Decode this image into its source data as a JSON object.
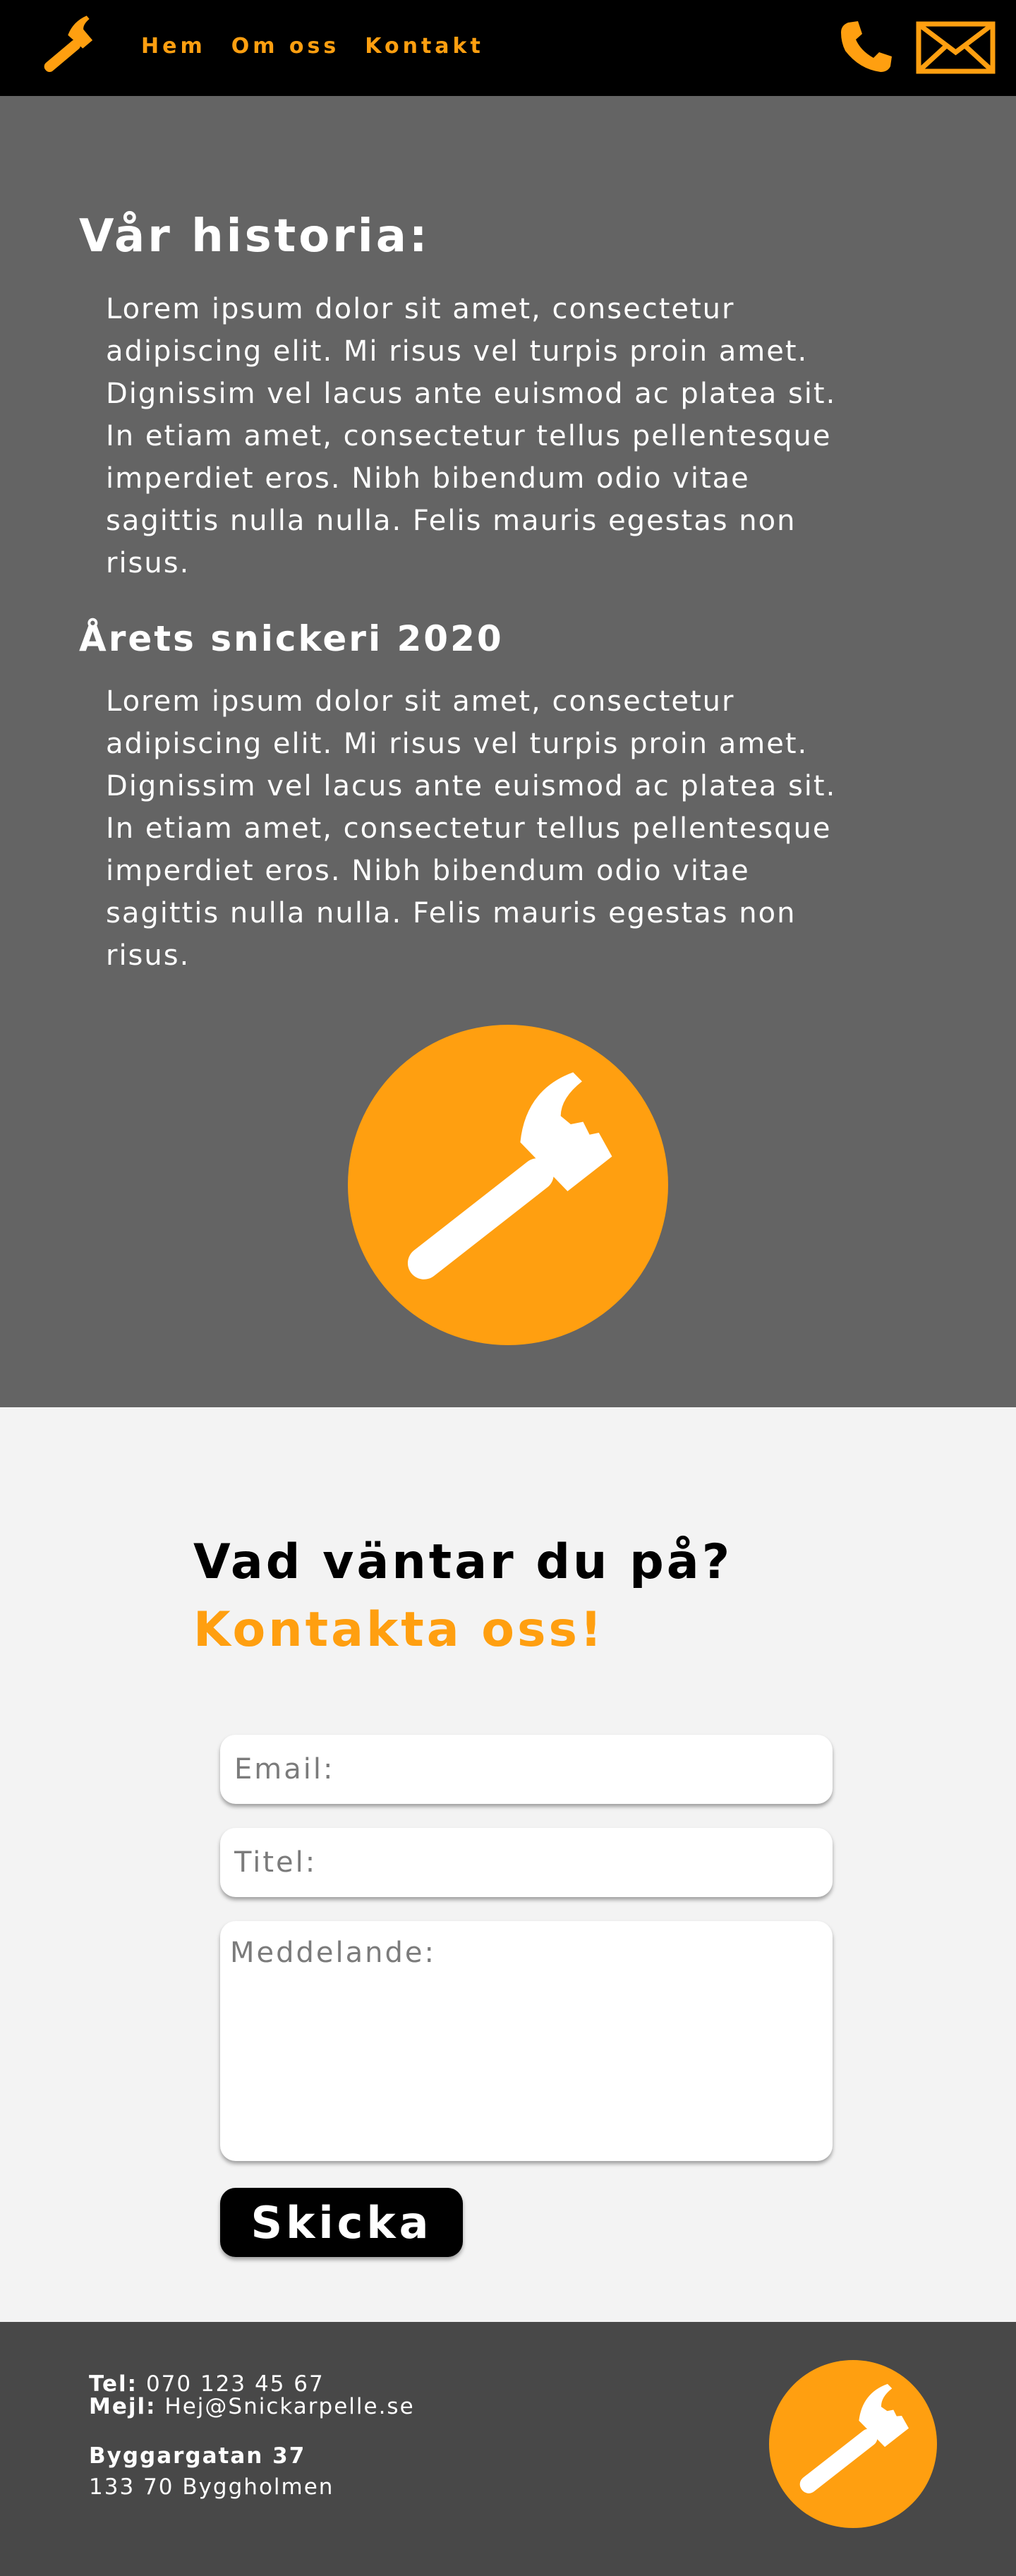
{
  "nav": {
    "items": [
      "Hem",
      "Om oss",
      "Kontakt"
    ]
  },
  "icons": {
    "logo": "hammer-icon",
    "phone": "phone-icon",
    "mail": "mail-icon"
  },
  "colors": {
    "accent": "#ff9f10",
    "header_bg": "#000000",
    "about_bg": "#646464",
    "contact_bg": "#f3f3f3",
    "footer_bg": "#484848"
  },
  "about": {
    "history_title": "Vår historia:",
    "history_text": "Lorem ipsum dolor sit amet, consectetur adipiscing elit. Mi risus vel turpis proin amet. Dignissim vel lacus ante euismod ac platea sit. In etiam amet, consectetur tellus pellentesque imperdiet eros. Nibh bibendum odio vitae sagittis nulla nulla. Felis mauris egestas non risus.",
    "year_title": "Årets snickeri 2020",
    "year_text": "Lorem ipsum dolor sit amet, consectetur adipiscing elit. Mi risus vel turpis proin amet. Dignissim vel lacus ante euismod ac platea sit. In etiam amet, consectetur tellus pellentesque imperdiet eros. Nibh bibendum odio vitae sagittis nulla nulla. Felis mauris egestas non risus."
  },
  "contact": {
    "heading": "Vad väntar du på?",
    "subheading": "Kontakta oss!",
    "email_placeholder": "Email:",
    "title_placeholder": "Titel:",
    "message_placeholder": "Meddelande:",
    "send_label": "Skicka"
  },
  "footer": {
    "tel_label": "Tel:",
    "tel_value": "070 123 45 67",
    "mail_label": "Mejl:",
    "mail_value": "Hej@Snickarpelle.se",
    "street": "Byggargatan 37",
    "city": "133 70 Byggholmen"
  }
}
